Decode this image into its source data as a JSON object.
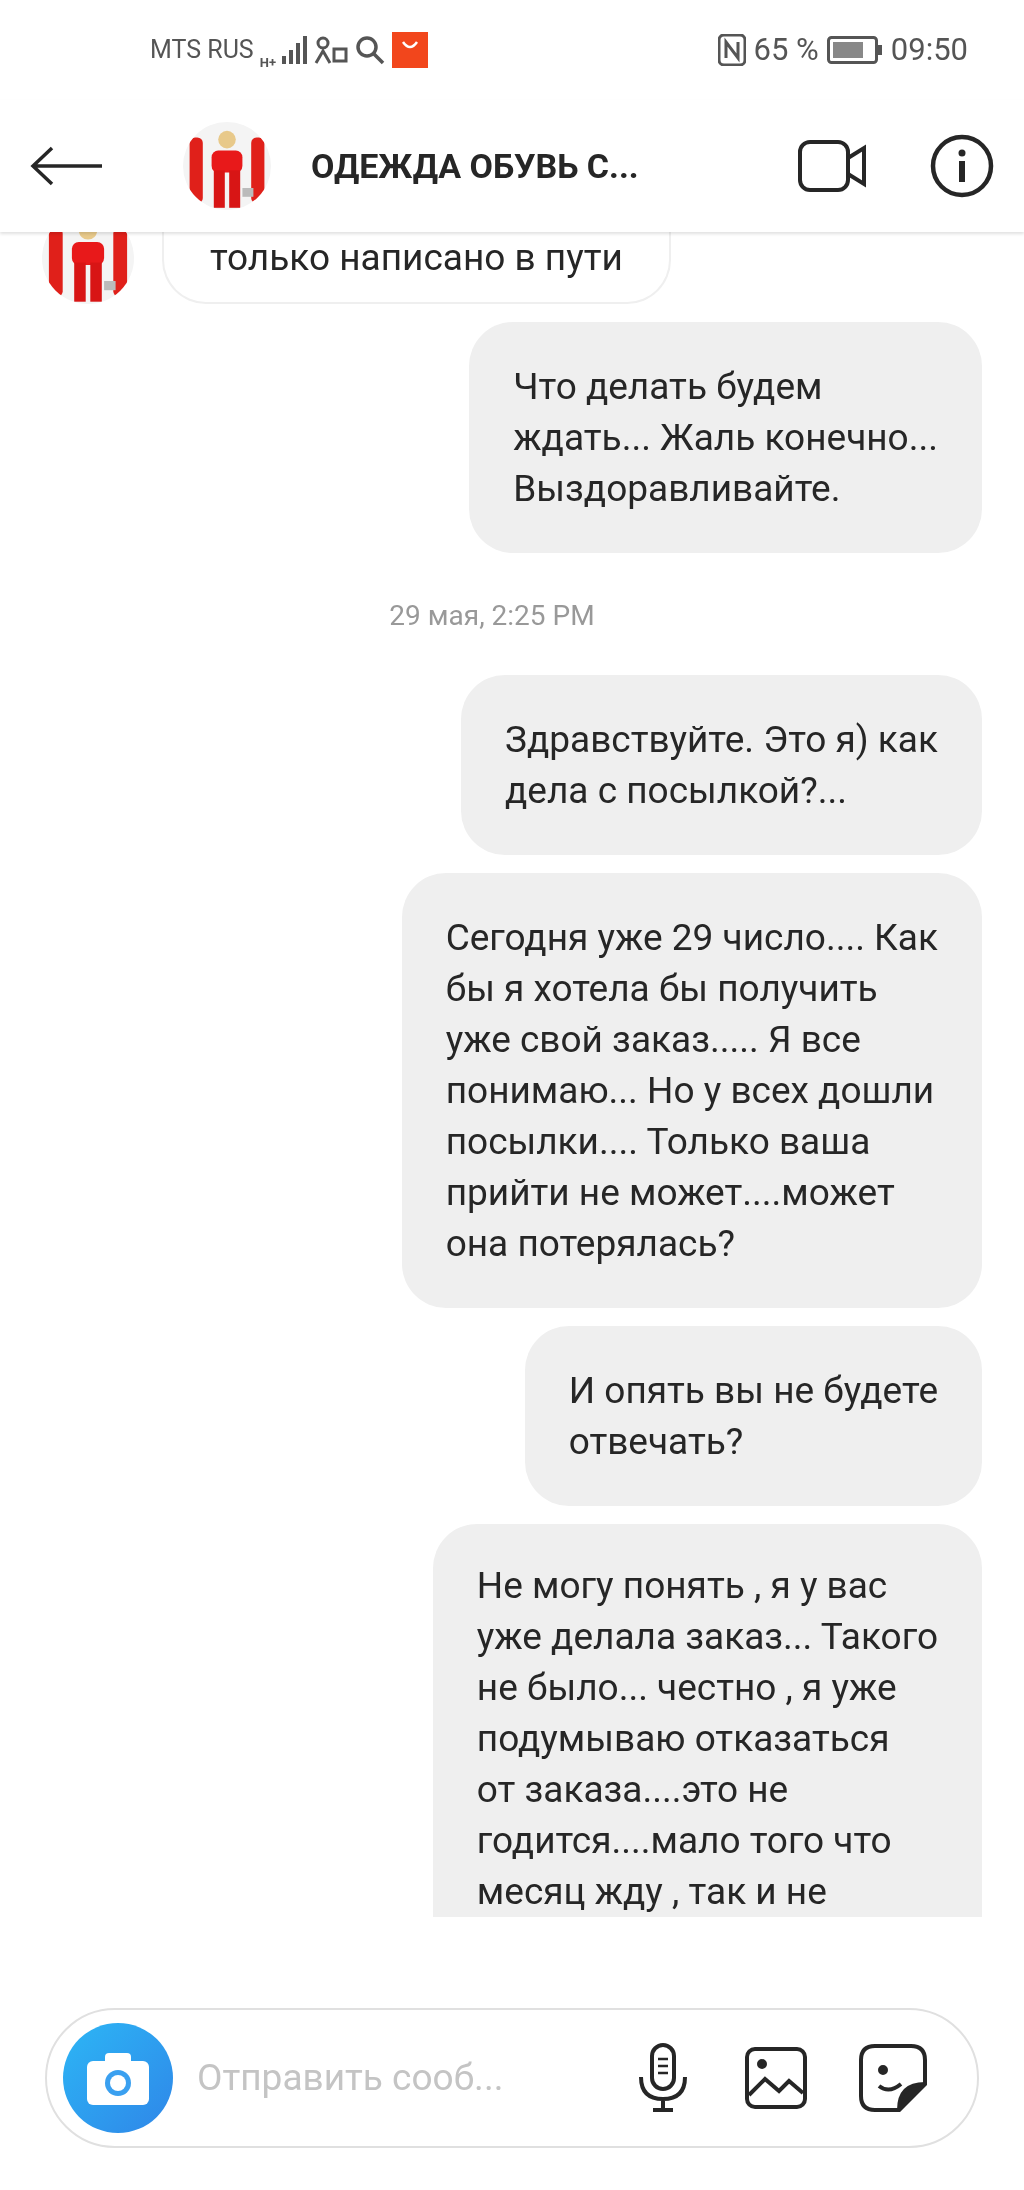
{
  "status_bar": {
    "carrier": "MTS RUS",
    "network": "H+",
    "battery_percent": "65 %",
    "time": "09:50"
  },
  "header": {
    "title": "ОДЕЖДА ОБУВЬ С..."
  },
  "messages": [
    {
      "kind": "incoming",
      "lines": [
        "только написано в пути"
      ]
    },
    {
      "kind": "outgoing",
      "lines": [
        "Что делать будем",
        "ждать... Жаль конечно...",
        "Выздоравливайте."
      ]
    },
    {
      "kind": "timestamp",
      "lines": [
        "29 мая, 2:25 PM"
      ]
    },
    {
      "kind": "outgoing",
      "lines": [
        "Здравствуйте. Это я) как",
        "дела с посылкой?..."
      ]
    },
    {
      "kind": "outgoing",
      "lines": [
        "Сегодня уже 29 число.... Как",
        "бы я хотела бы получить",
        "уже свой заказ..... Я все",
        "понимаю... Но у всех дошли",
        "посылки.... Только ваша",
        "прийти не может....может",
        "она потерялась?"
      ]
    },
    {
      "kind": "outgoing",
      "lines": [
        "И опять вы не будете",
        "отвечать?"
      ]
    },
    {
      "kind": "outgoing",
      "lines": [
        "Не могу понять , я у вас",
        "уже делала заказ... Такого",
        "не было... честно , я уже",
        "подумываю отказаться",
        "от заказа....это не",
        "годится....мало того что",
        "месяц жду , так и не"
      ]
    }
  ],
  "composer": {
    "placeholder": "Отправить сооб..."
  }
}
